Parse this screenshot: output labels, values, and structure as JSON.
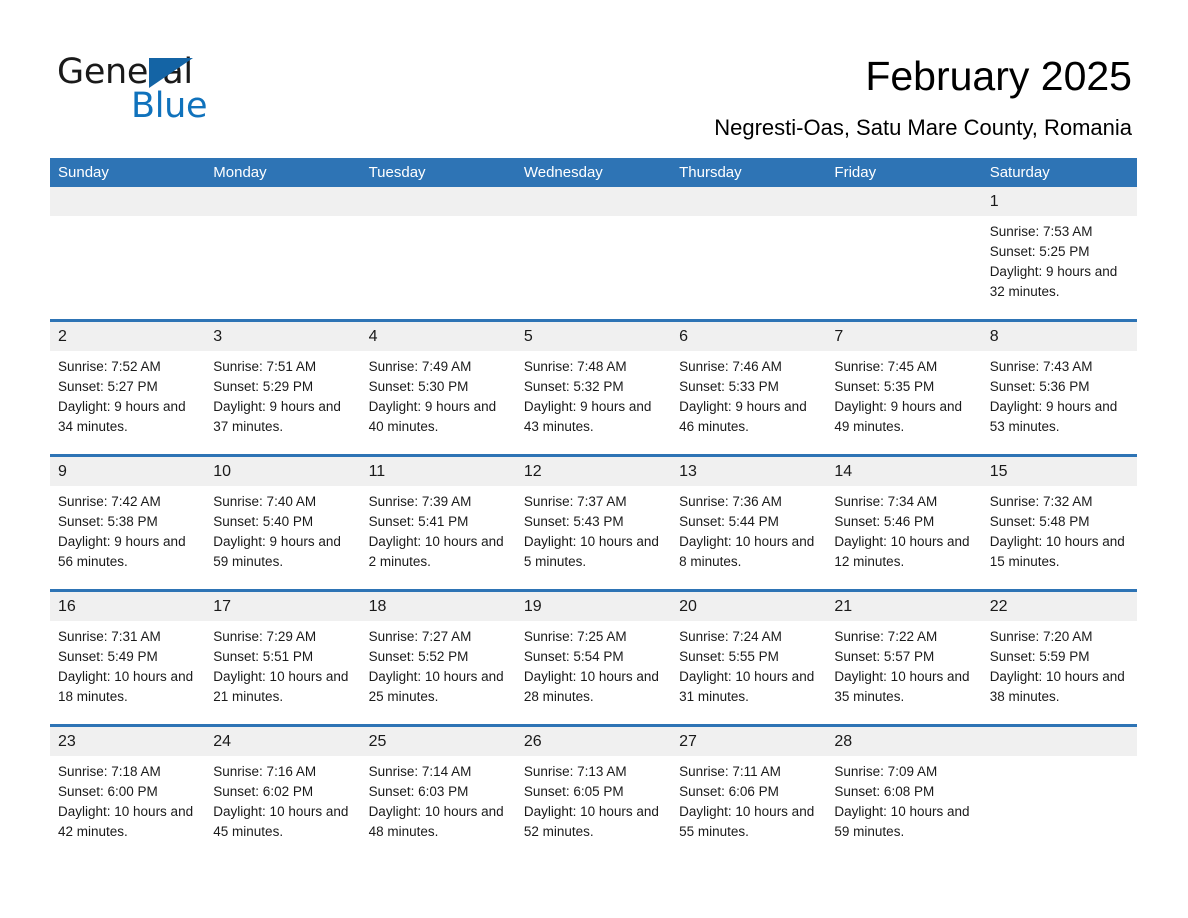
{
  "brand": {
    "name_part1": "General",
    "name_part2": "Blue",
    "accent_color": "#1072BC",
    "header_color": "#2E74B5"
  },
  "header": {
    "title": "February 2025",
    "subtitle": "Negresti-Oas, Satu Mare County, Romania"
  },
  "calendar": {
    "weekdays": [
      "Sunday",
      "Monday",
      "Tuesday",
      "Wednesday",
      "Thursday",
      "Friday",
      "Saturday"
    ],
    "weeks": [
      [
        {
          "day": "",
          "sunrise": "",
          "sunset": "",
          "daylight": "",
          "empty": true
        },
        {
          "day": "",
          "sunrise": "",
          "sunset": "",
          "daylight": "",
          "empty": true
        },
        {
          "day": "",
          "sunrise": "",
          "sunset": "",
          "daylight": "",
          "empty": true
        },
        {
          "day": "",
          "sunrise": "",
          "sunset": "",
          "daylight": "",
          "empty": true
        },
        {
          "day": "",
          "sunrise": "",
          "sunset": "",
          "daylight": "",
          "empty": true
        },
        {
          "day": "",
          "sunrise": "",
          "sunset": "",
          "daylight": "",
          "empty": true
        },
        {
          "day": "1",
          "sunrise": "Sunrise: 7:53 AM",
          "sunset": "Sunset: 5:25 PM",
          "daylight": "Daylight: 9 hours and 32 minutes.",
          "empty": false
        }
      ],
      [
        {
          "day": "2",
          "sunrise": "Sunrise: 7:52 AM",
          "sunset": "Sunset: 5:27 PM",
          "daylight": "Daylight: 9 hours and 34 minutes.",
          "empty": false
        },
        {
          "day": "3",
          "sunrise": "Sunrise: 7:51 AM",
          "sunset": "Sunset: 5:29 PM",
          "daylight": "Daylight: 9 hours and 37 minutes.",
          "empty": false
        },
        {
          "day": "4",
          "sunrise": "Sunrise: 7:49 AM",
          "sunset": "Sunset: 5:30 PM",
          "daylight": "Daylight: 9 hours and 40 minutes.",
          "empty": false
        },
        {
          "day": "5",
          "sunrise": "Sunrise: 7:48 AM",
          "sunset": "Sunset: 5:32 PM",
          "daylight": "Daylight: 9 hours and 43 minutes.",
          "empty": false
        },
        {
          "day": "6",
          "sunrise": "Sunrise: 7:46 AM",
          "sunset": "Sunset: 5:33 PM",
          "daylight": "Daylight: 9 hours and 46 minutes.",
          "empty": false
        },
        {
          "day": "7",
          "sunrise": "Sunrise: 7:45 AM",
          "sunset": "Sunset: 5:35 PM",
          "daylight": "Daylight: 9 hours and 49 minutes.",
          "empty": false
        },
        {
          "day": "8",
          "sunrise": "Sunrise: 7:43 AM",
          "sunset": "Sunset: 5:36 PM",
          "daylight": "Daylight: 9 hours and 53 minutes.",
          "empty": false
        }
      ],
      [
        {
          "day": "9",
          "sunrise": "Sunrise: 7:42 AM",
          "sunset": "Sunset: 5:38 PM",
          "daylight": "Daylight: 9 hours and 56 minutes.",
          "empty": false
        },
        {
          "day": "10",
          "sunrise": "Sunrise: 7:40 AM",
          "sunset": "Sunset: 5:40 PM",
          "daylight": "Daylight: 9 hours and 59 minutes.",
          "empty": false
        },
        {
          "day": "11",
          "sunrise": "Sunrise: 7:39 AM",
          "sunset": "Sunset: 5:41 PM",
          "daylight": "Daylight: 10 hours and 2 minutes.",
          "empty": false
        },
        {
          "day": "12",
          "sunrise": "Sunrise: 7:37 AM",
          "sunset": "Sunset: 5:43 PM",
          "daylight": "Daylight: 10 hours and 5 minutes.",
          "empty": false
        },
        {
          "day": "13",
          "sunrise": "Sunrise: 7:36 AM",
          "sunset": "Sunset: 5:44 PM",
          "daylight": "Daylight: 10 hours and 8 minutes.",
          "empty": false
        },
        {
          "day": "14",
          "sunrise": "Sunrise: 7:34 AM",
          "sunset": "Sunset: 5:46 PM",
          "daylight": "Daylight: 10 hours and 12 minutes.",
          "empty": false
        },
        {
          "day": "15",
          "sunrise": "Sunrise: 7:32 AM",
          "sunset": "Sunset: 5:48 PM",
          "daylight": "Daylight: 10 hours and 15 minutes.",
          "empty": false
        }
      ],
      [
        {
          "day": "16",
          "sunrise": "Sunrise: 7:31 AM",
          "sunset": "Sunset: 5:49 PM",
          "daylight": "Daylight: 10 hours and 18 minutes.",
          "empty": false
        },
        {
          "day": "17",
          "sunrise": "Sunrise: 7:29 AM",
          "sunset": "Sunset: 5:51 PM",
          "daylight": "Daylight: 10 hours and 21 minutes.",
          "empty": false
        },
        {
          "day": "18",
          "sunrise": "Sunrise: 7:27 AM",
          "sunset": "Sunset: 5:52 PM",
          "daylight": "Daylight: 10 hours and 25 minutes.",
          "empty": false
        },
        {
          "day": "19",
          "sunrise": "Sunrise: 7:25 AM",
          "sunset": "Sunset: 5:54 PM",
          "daylight": "Daylight: 10 hours and 28 minutes.",
          "empty": false
        },
        {
          "day": "20",
          "sunrise": "Sunrise: 7:24 AM",
          "sunset": "Sunset: 5:55 PM",
          "daylight": "Daylight: 10 hours and 31 minutes.",
          "empty": false
        },
        {
          "day": "21",
          "sunrise": "Sunrise: 7:22 AM",
          "sunset": "Sunset: 5:57 PM",
          "daylight": "Daylight: 10 hours and 35 minutes.",
          "empty": false
        },
        {
          "day": "22",
          "sunrise": "Sunrise: 7:20 AM",
          "sunset": "Sunset: 5:59 PM",
          "daylight": "Daylight: 10 hours and 38 minutes.",
          "empty": false
        }
      ],
      [
        {
          "day": "23",
          "sunrise": "Sunrise: 7:18 AM",
          "sunset": "Sunset: 6:00 PM",
          "daylight": "Daylight: 10 hours and 42 minutes.",
          "empty": false
        },
        {
          "day": "24",
          "sunrise": "Sunrise: 7:16 AM",
          "sunset": "Sunset: 6:02 PM",
          "daylight": "Daylight: 10 hours and 45 minutes.",
          "empty": false
        },
        {
          "day": "25",
          "sunrise": "Sunrise: 7:14 AM",
          "sunset": "Sunset: 6:03 PM",
          "daylight": "Daylight: 10 hours and 48 minutes.",
          "empty": false
        },
        {
          "day": "26",
          "sunrise": "Sunrise: 7:13 AM",
          "sunset": "Sunset: 6:05 PM",
          "daylight": "Daylight: 10 hours and 52 minutes.",
          "empty": false
        },
        {
          "day": "27",
          "sunrise": "Sunrise: 7:11 AM",
          "sunset": "Sunset: 6:06 PM",
          "daylight": "Daylight: 10 hours and 55 minutes.",
          "empty": false
        },
        {
          "day": "28",
          "sunrise": "Sunrise: 7:09 AM",
          "sunset": "Sunset: 6:08 PM",
          "daylight": "Daylight: 10 hours and 59 minutes.",
          "empty": false
        },
        {
          "day": "",
          "sunrise": "",
          "sunset": "",
          "daylight": "",
          "empty": true
        }
      ]
    ]
  }
}
